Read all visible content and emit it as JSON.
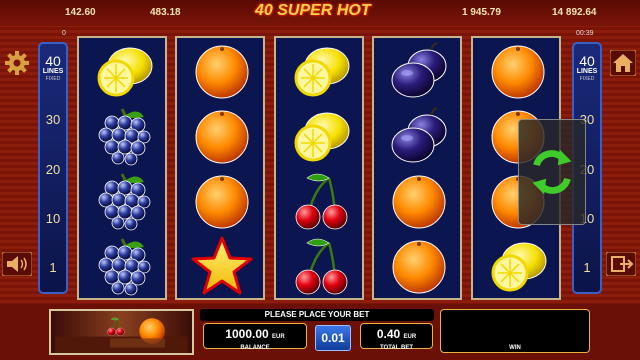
{
  "header": {
    "jackpots": [
      "142.60",
      "483.18",
      "1 945.79",
      "14 892.64"
    ],
    "logo_text": "40 SUPER HOT",
    "left_small": "0",
    "timer": "00:39"
  },
  "lines_panel": {
    "lines_count": "40",
    "lines_label": "LINES",
    "lines_fixed": "FIXED",
    "markers": [
      "30",
      "20",
      "10",
      "1"
    ]
  },
  "reels": [
    [
      "lemon",
      "grapes",
      "grapes",
      "grapes"
    ],
    [
      "orange",
      "orange",
      "orange",
      "star"
    ],
    [
      "lemon",
      "lemon",
      "cherries",
      "cherries"
    ],
    [
      "plum",
      "plum",
      "orange",
      "orange"
    ],
    [
      "orange",
      "orange",
      "orange",
      "lemon"
    ]
  ],
  "icons": {
    "settings": "gear-icon",
    "home": "home-icon",
    "sound": "speaker-icon",
    "exit": "exit-icon",
    "autospin": "refresh-icon"
  },
  "bottom": {
    "message": "PLEASE PLACE YOUR BET",
    "balance_value": "1000.00",
    "balance_currency": "EUR",
    "balance_label": "BALANCE",
    "bet_step": "0.01",
    "total_bet_value": "0.40",
    "total_bet_currency": "EUR",
    "total_bet_label": "TOTAL BET",
    "win_label": "WIN"
  },
  "colors": {
    "background": "#7a1408",
    "reel_bg": "#0b1550",
    "accent": "#e8b440",
    "panel_blue": "#1a2a7a"
  }
}
